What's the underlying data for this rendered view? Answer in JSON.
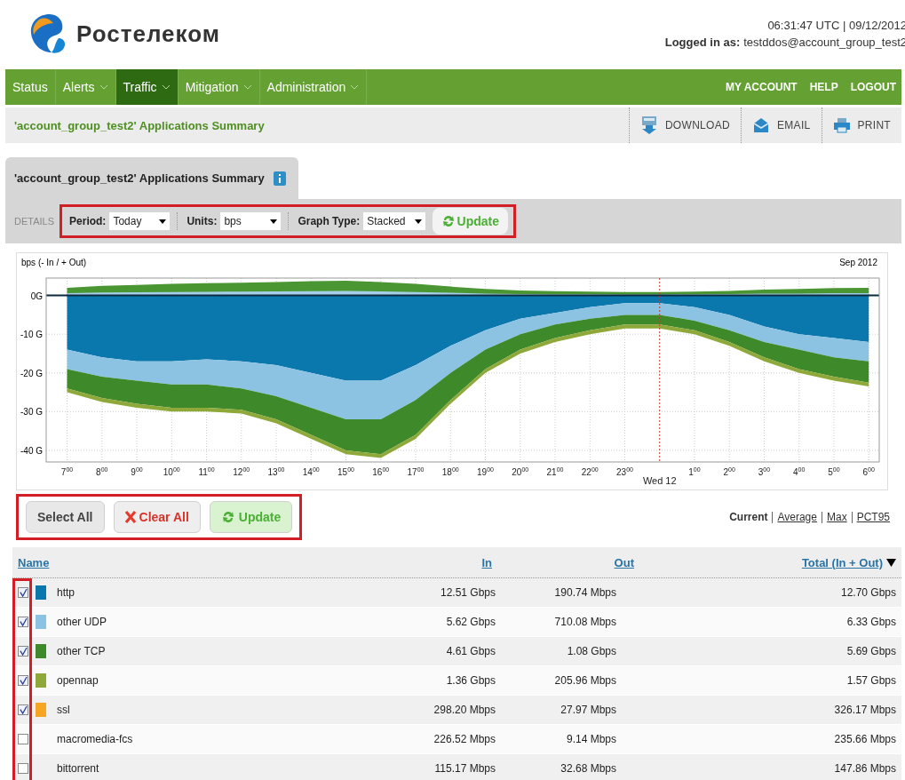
{
  "header": {
    "brand": "Ростелеком",
    "datetime": "06:31:47 UTC | 09/12/2012",
    "login_label": "Logged in as:",
    "login_user": "testddos@account_group_test2"
  },
  "nav": {
    "items": [
      {
        "label": "Status",
        "selected": false,
        "has_menu": false
      },
      {
        "label": "Alerts",
        "selected": false,
        "has_menu": true
      },
      {
        "label": "Traffic",
        "selected": true,
        "has_menu": true
      },
      {
        "label": "Mitigation",
        "selected": false,
        "has_menu": true
      },
      {
        "label": "Administration",
        "selected": false,
        "has_menu": true
      }
    ],
    "account_links": [
      "MY ACCOUNT",
      "HELP",
      "LOGOUT"
    ]
  },
  "page_bar": {
    "title": "'account_group_test2' Applications Summary",
    "actions": [
      {
        "kind": "download",
        "label": "DOWNLOAD"
      },
      {
        "kind": "email",
        "label": "EMAIL"
      },
      {
        "kind": "print",
        "label": "PRINT"
      }
    ]
  },
  "tab": {
    "label": "'account_group_test2' Applications Summary"
  },
  "details": {
    "label": "DETAILS",
    "filters": [
      {
        "label": "Period:",
        "value": "Today"
      },
      {
        "label": "Units:",
        "value": "bps"
      },
      {
        "label": "Graph Type:",
        "value": "Stacked"
      }
    ],
    "update": "Update"
  },
  "chart": {
    "chart_data": {
      "type": "area",
      "stacked": true,
      "title": "Sep 2012",
      "ylabel": "bps (- In / + Out)",
      "categories": [
        "7$^{00}$",
        "8$^{00}$",
        "9$^{00}$",
        "10$^{00}$",
        "11$^{00}$",
        "12$^{00}$",
        "13$^{00}$",
        "14$^{00}$",
        "15$^{00}$",
        "16$^{00}$",
        "17$^{00}$",
        "18$^{00}$",
        "19$^{00}$",
        "20$^{00}$",
        "21$^{00}$",
        "22$^{00}$",
        "23$^{00}$",
        "Wed 12",
        "1$^{00}$",
        "2$^{00}$",
        "3$^{00}$",
        "4$^{00}$",
        "5$^{00}$",
        "6$^{00}$"
      ],
      "ylim": [
        -43,
        4.5
      ],
      "yticks": [
        {
          "value": 0,
          "label": "0G"
        },
        {
          "value": -10,
          "label": "-10 G"
        },
        {
          "value": -20,
          "label": "-20 G"
        },
        {
          "value": -30,
          "label": "-30 G"
        },
        {
          "value": -40,
          "label": "-40 G"
        }
      ],
      "grid": true,
      "ref_lines": [
        {
          "axis": "x",
          "value": "Wed 12",
          "color": "#c0392b"
        }
      ],
      "series": [
        {
          "color": "#0a77ad",
          "values": [
            -14,
            -16,
            -17,
            -17,
            -16.5,
            -17,
            -18,
            -20,
            -22,
            -22,
            -18,
            -13,
            -9,
            -6,
            -4.5,
            -3,
            -2,
            -2,
            -3,
            -5,
            -8,
            -10,
            -11,
            -12
          ]
        },
        {
          "color": "#8cc3e3",
          "values": [
            -5,
            -5,
            -5,
            -6,
            -6.5,
            -7,
            -8,
            -9,
            -10,
            -10,
            -9,
            -7,
            -5,
            -4,
            -3,
            -3,
            -3,
            -3,
            -3.5,
            -4,
            -4,
            -4,
            -5,
            -5
          ]
        },
        {
          "color": "#3e8a2a",
          "values": [
            -5,
            -5.5,
            -6,
            -6,
            -6,
            -5.5,
            -6,
            -7,
            -8,
            -9,
            -9,
            -7,
            -5,
            -4,
            -3.5,
            -3,
            -2.5,
            -2.5,
            -2.5,
            -3,
            -4,
            -5,
            -5,
            -5.5
          ]
        },
        {
          "color": "#8fa83a",
          "values": [
            -1,
            -1,
            -1,
            -1,
            -1,
            -1,
            -1,
            -1,
            -1,
            -1,
            -1,
            -1,
            -1,
            -1,
            -1,
            -1,
            -1,
            -1,
            -1,
            -1,
            -1,
            -1,
            -1,
            -1
          ]
        }
      ]
    }
  },
  "controls": {
    "buttons": [
      {
        "kind": "select",
        "label": "Select All"
      },
      {
        "kind": "clear",
        "label": "Clear All"
      },
      {
        "kind": "update",
        "label": "Update"
      }
    ],
    "metrics": [
      {
        "label": "Current",
        "selected": true
      },
      {
        "label": "Average",
        "selected": false
      },
      {
        "label": "Max",
        "selected": false
      },
      {
        "label": "PCT95",
        "selected": false
      }
    ]
  },
  "table": {
    "columns": [
      {
        "label": "Name",
        "sorted": false
      },
      {
        "label": "In",
        "sorted": false
      },
      {
        "label": "Out",
        "sorted": false
      },
      {
        "label": "Total (In + Out)",
        "sorted": true
      }
    ],
    "rows": [
      {
        "checked": true,
        "color": "#0a77ad",
        "name": "http",
        "in": "12.51 Gbps",
        "out": "190.74 Mbps",
        "total": "12.70 Gbps"
      },
      {
        "checked": true,
        "color": "#8cc3e3",
        "name": "other UDP",
        "in": "5.62 Gbps",
        "out": "710.08 Mbps",
        "total": "6.33 Gbps"
      },
      {
        "checked": true,
        "color": "#3e8a2a",
        "name": "other TCP",
        "in": "4.61 Gbps",
        "out": "1.08 Gbps",
        "total": "5.69 Gbps"
      },
      {
        "checked": true,
        "color": "#8fa83a",
        "name": "opennap",
        "in": "1.36 Gbps",
        "out": "205.96 Mbps",
        "total": "1.57 Gbps"
      },
      {
        "checked": true,
        "color": "#f7a623",
        "name": "ssl",
        "in": "298.20 Mbps",
        "out": "27.97 Mbps",
        "total": "326.17 Mbps"
      },
      {
        "checked": false,
        "name": "macromedia-fcs",
        "in": "226.52 Mbps",
        "out": "9.14 Mbps",
        "total": "235.66 Mbps"
      },
      {
        "checked": false,
        "name": "bittorrent",
        "in": "115.17 Mbps",
        "out": "32.68 Mbps",
        "total": "147.86 Mbps"
      }
    ]
  }
}
